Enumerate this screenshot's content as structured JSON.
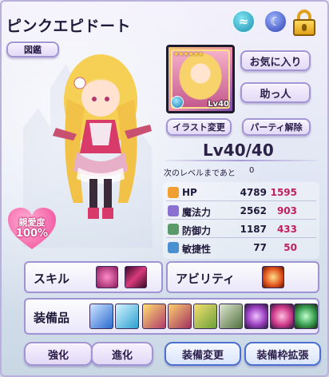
{
  "header": {
    "title": "ピンクエピドート"
  },
  "buttons": {
    "zukan": "図鑑",
    "favorite": "お気に入り",
    "helper": "助っ人",
    "illust_change": "イラスト変更",
    "party_release": "パーティ解除"
  },
  "portrait": {
    "stars": "★★★★★★",
    "level": "Lv40"
  },
  "level": {
    "display": "Lv40/40",
    "next_label": "次のレベルまであと",
    "next_value": "0"
  },
  "stats": [
    {
      "name": "HP",
      "value": "4789",
      "bonus": "1595",
      "icon_color": "#f0a030",
      "icon": "heart-shield-icon"
    },
    {
      "name": "魔法力",
      "value": "2562",
      "bonus": "903",
      "icon_color": "#8a70d0",
      "icon": "magic-wand-icon"
    },
    {
      "name": "防御力",
      "value": "1187",
      "bonus": "433",
      "icon_color": "#5a9a6a",
      "icon": "armor-icon"
    },
    {
      "name": "敏捷性",
      "value": "77",
      "bonus": "50",
      "icon_color": "#4a90d0",
      "icon": "wing-icon"
    }
  ],
  "affinity": {
    "label": "親愛度",
    "value": "100%"
  },
  "panels": {
    "skill_label": "スキル",
    "ability_label": "アビリティ",
    "equip_label": "装備品"
  },
  "skills": [
    {
      "icon": "pink-burst-skill-icon",
      "color": "#d23a8a"
    },
    {
      "icon": "dark-slash-skill-icon",
      "color": "#7a1a5a"
    }
  ],
  "ability": {
    "icon": "cross-flame-ability-icon",
    "color": "#e0501a"
  },
  "equipment": [
    {
      "icon": "sword-equip-icon",
      "color": "#2a6ad0"
    },
    {
      "icon": "bow-equip-icon",
      "color": "#2aa0d0"
    },
    {
      "icon": "pink-figure-equip-icon",
      "color": "#b03a6a"
    },
    {
      "icon": "pink-figure-2-equip-icon",
      "color": "#a03060"
    },
    {
      "icon": "green-figure-equip-icon",
      "color": "#6aa03a"
    },
    {
      "icon": "knight-equip-icon",
      "color": "#507040"
    },
    {
      "icon": "amethyst-gem-equip-icon",
      "color": "#9a40c0"
    },
    {
      "icon": "ruby-gem-equip-icon",
      "color": "#d03a8a"
    },
    {
      "icon": "emerald-gem-equip-icon",
      "color": "#3aa050"
    }
  ],
  "bottom_bar": {
    "enhance": "強化",
    "evolve": "進化",
    "equip_change": "装備変更",
    "equip_expand": "装備枠拡張"
  },
  "colors": {
    "bonus": "#c02060",
    "frame": "#b9b0dd"
  }
}
